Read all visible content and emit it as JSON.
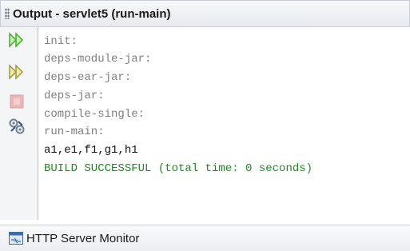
{
  "panel": {
    "title": "Output - servlet5 (run-main)"
  },
  "toolbar": {
    "buttons": [
      {
        "name": "rerun-button",
        "icon": "rerun-icon"
      },
      {
        "name": "rerun-with-parameters-button",
        "icon": "rerun-with-parameters-icon"
      },
      {
        "name": "stop-button",
        "icon": "stop-icon"
      },
      {
        "name": "ant-settings-button",
        "icon": "settings-icon"
      }
    ]
  },
  "output": {
    "lines": [
      {
        "text": "init:",
        "style": "gray"
      },
      {
        "text": "deps-module-jar:",
        "style": "gray"
      },
      {
        "text": "deps-ear-jar:",
        "style": "gray"
      },
      {
        "text": "deps-jar:",
        "style": "gray"
      },
      {
        "text": "compile-single:",
        "style": "gray"
      },
      {
        "text": "run-main:",
        "style": "gray"
      },
      {
        "text": "a1,e1,f1,g1,h1",
        "style": "black"
      },
      {
        "text": "BUILD SUCCESSFUL (total time: 0 seconds)",
        "style": "green"
      }
    ]
  },
  "footer": {
    "label": "HTTP Server Monitor",
    "icon": "http-monitor-icon"
  },
  "colors": {
    "target_text": "#7f7f7f",
    "output_text": "#111111",
    "success_text": "#1f8a1f",
    "run_icon": "#3fae2a"
  }
}
